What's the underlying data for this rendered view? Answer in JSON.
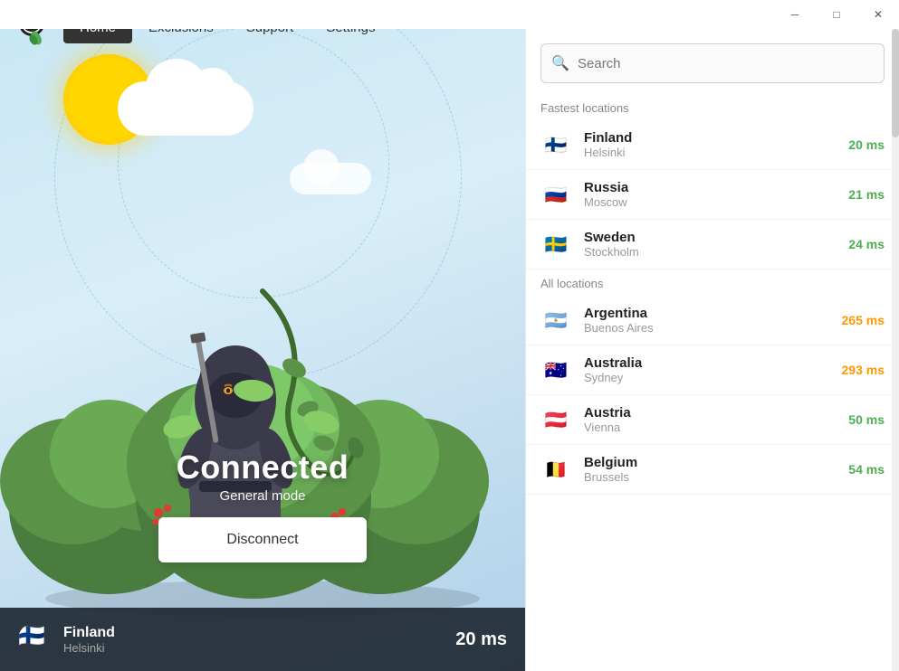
{
  "titleBar": {
    "minimizeLabel": "─",
    "maximizeLabel": "□",
    "closeLabel": "✕"
  },
  "navbar": {
    "homeLabel": "Home",
    "exclusionsLabel": "Exclusions",
    "supportLabel": "Support",
    "settingsLabel": "Settings"
  },
  "status": {
    "connected": "Connected",
    "mode": "General mode",
    "disconnectBtn": "Disconnect"
  },
  "bottomBar": {
    "country": "Finland",
    "city": "Helsinki",
    "ms": "20 ms"
  },
  "search": {
    "placeholder": "Search"
  },
  "fastestLocations": {
    "label": "Fastest locations",
    "items": [
      {
        "country": "Finland",
        "city": "Helsinki",
        "ms": "20 ms",
        "msClass": "ms-fast",
        "flag": "🇫🇮"
      },
      {
        "country": "Russia",
        "city": "Moscow",
        "ms": "21 ms",
        "msClass": "ms-fast",
        "flag": "🇷🇺"
      },
      {
        "country": "Sweden",
        "city": "Stockholm",
        "ms": "24 ms",
        "msClass": "ms-fast",
        "flag": "🇸🇪"
      }
    ]
  },
  "allLocations": {
    "label": "All locations",
    "items": [
      {
        "country": "Argentina",
        "city": "Buenos Aires",
        "ms": "265 ms",
        "msClass": "ms-medium",
        "flag": "🇦🇷"
      },
      {
        "country": "Australia",
        "city": "Sydney",
        "ms": "293 ms",
        "msClass": "ms-medium",
        "flag": "🇦🇺"
      },
      {
        "country": "Austria",
        "city": "Vienna",
        "ms": "50 ms",
        "msClass": "ms-fast",
        "flag": "🇦🇹"
      },
      {
        "country": "Belgium",
        "city": "Brussels",
        "ms": "54 ms",
        "msClass": "ms-fast",
        "flag": "🇧🇪"
      }
    ]
  }
}
